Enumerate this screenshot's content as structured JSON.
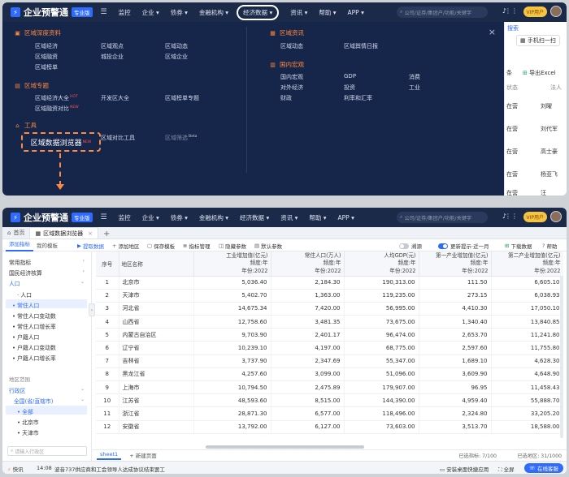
{
  "app": {
    "logo_text": "企业预警通",
    "pro_badge": "专业版",
    "menu_icon": "menu-icon",
    "nav": [
      "监控",
      "企业",
      "债券",
      "金融机构",
      "经济数据",
      "资讯",
      "帮助",
      "APP"
    ],
    "nav_chevron": "▾",
    "search_placeholder": "公司/证券/集团户/功能/关键字",
    "vip_label": "VIP用户"
  },
  "dropdown": {
    "sections": {
      "deep": "区域深度资料",
      "topic": "区域专题",
      "tools": "工具",
      "news": "区域资讯",
      "macro": "国内宏观"
    },
    "deep_links": [
      "区域经济",
      "区域观点",
      "区域动态",
      "区域融资",
      "城投企业",
      "区域企业",
      "区域榜单"
    ],
    "topic_links": [
      "区域经济大全",
      "开发区大全",
      "区域榜单专题",
      "区域融资对比"
    ],
    "hot_badge": "HOT",
    "new_badge": "NEW",
    "beta_badge": "Beta",
    "tool_links": [
      "区域数据浏览器",
      "区域对比工具",
      "区域筛选"
    ],
    "news_links": [
      "区域动态",
      "区域舆情日报"
    ],
    "macro_links": [
      "国内宏观",
      "GDP",
      "消费",
      "对外经济",
      "投资",
      "工业",
      "财政",
      "利率和汇率"
    ],
    "close_icon": "×"
  },
  "right_panel": {
    "search_label": "搜索",
    "manual_btn": "手机扫一扫",
    "item_tiao": "条",
    "export_excel": "导出Excel",
    "col_status": "状态",
    "col_fa": "法人",
    "rows": [
      {
        "status": "在营",
        "name": "刘曜"
      },
      {
        "status": "在营",
        "name": "刘代军"
      },
      {
        "status": "在营",
        "name": "高士豪"
      },
      {
        "status": "在营",
        "name": "杨亚飞"
      },
      {
        "status": "在营",
        "name": "汪"
      }
    ]
  },
  "tabs": {
    "home": "首页",
    "active": "区域数据浏览器"
  },
  "toolbar": {
    "side_tabs": [
      "添加指标",
      "我的模板"
    ],
    "buttons": [
      "提取数据",
      "添加地区",
      "保存模板",
      "指标管理",
      "隐藏参数",
      "默认参数"
    ],
    "trace_label": "溯源",
    "update_label": "更新提示·近一月",
    "download_label": "下载数据",
    "help_label": "帮助"
  },
  "sidebar": {
    "groups": [
      "常用指标",
      "国民经济核算",
      "人口"
    ],
    "population_items": [
      "人口",
      "常住人口",
      "常住人口变动数",
      "常住人口增长率",
      "户籍人口",
      "户籍人口变动数",
      "户籍人口增长率"
    ],
    "region_label": "地区范围",
    "region_group": "行政区",
    "region_items": [
      "全国(省/直辖市)",
      "全部",
      "北京市",
      "天津市"
    ],
    "search_placeholder": "请输入行政区"
  },
  "table": {
    "headers": {
      "idx": "序号",
      "region": "地区名称",
      "freq_label": "频度:",
      "year_label": "年份:",
      "freq_value": "年",
      "year_value": "2022",
      "cols": [
        "工业增加值(亿元)",
        "常住人口(万人)",
        "人均GDP(元)",
        "第一产业增加值(亿元)",
        "第二产业增加值(亿元)"
      ]
    },
    "rows": [
      {
        "idx": "1",
        "region": "北京市",
        "v": [
          "5,036.40",
          "2,184.30",
          "190,313.00",
          "111.50",
          "6,605.10"
        ]
      },
      {
        "idx": "2",
        "region": "天津市",
        "v": [
          "5,402.70",
          "1,363.00",
          "119,235.00",
          "273.15",
          "6,038.93"
        ]
      },
      {
        "idx": "3",
        "region": "河北省",
        "v": [
          "14,675.34",
          "7,420.00",
          "56,995.00",
          "4,410.30",
          "17,050.10"
        ]
      },
      {
        "idx": "4",
        "region": "山西省",
        "v": [
          "12,758.60",
          "3,481.35",
          "73,675.00",
          "1,340.40",
          "13,840.85"
        ]
      },
      {
        "idx": "5",
        "region": "内蒙古自治区",
        "v": [
          "9,703.90",
          "2,401.17",
          "96,474.00",
          "2,653.70",
          "11,241.80"
        ]
      },
      {
        "idx": "6",
        "region": "辽宁省",
        "v": [
          "10,239.10",
          "4,197.00",
          "68,775.00",
          "2,597.60",
          "11,755.80"
        ]
      },
      {
        "idx": "7",
        "region": "吉林省",
        "v": [
          "3,737.90",
          "2,347.69",
          "55,347.00",
          "1,689.10",
          "4,628.30"
        ]
      },
      {
        "idx": "8",
        "region": "黑龙江省",
        "v": [
          "4,257.60",
          "3,099.00",
          "51,096.00",
          "3,609.90",
          "4,648.90"
        ]
      },
      {
        "idx": "9",
        "region": "上海市",
        "v": [
          "10,794.50",
          "2,475.89",
          "179,907.00",
          "96.95",
          "11,458.43"
        ]
      },
      {
        "idx": "10",
        "region": "江苏省",
        "v": [
          "48,593.60",
          "8,515.00",
          "144,390.00",
          "4,959.40",
          "55,888.70"
        ]
      },
      {
        "idx": "11",
        "region": "浙江省",
        "v": [
          "28,871.30",
          "6,577.00",
          "118,496.00",
          "2,324.80",
          "33,205.20"
        ]
      },
      {
        "idx": "12",
        "region": "安徽省",
        "v": [
          "13,792.00",
          "6,127.00",
          "73,603.00",
          "3,513.70",
          "18,588.00"
        ]
      }
    ]
  },
  "bottom": {
    "sheet": "sheet1",
    "new_page": "新建页面",
    "selected_indicators": "已选指标: 7/100",
    "selected_regions": "已选地区: 31/1000"
  },
  "status": {
    "flash_label": "快讯",
    "time": "14:08",
    "news": "波音737供应商和工会领导人达成协议结束罢工",
    "desktop_shortcut": "安装桌面快捷应用",
    "fullscreen": "全屏",
    "service": "在线客服"
  }
}
